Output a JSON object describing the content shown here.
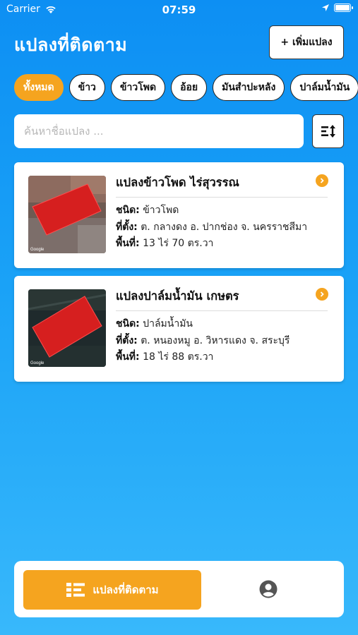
{
  "status_bar": {
    "carrier": "Carrier",
    "time": "07:59",
    "battery_percent": 100
  },
  "header": {
    "title": "แปลงที่ติดตาม",
    "add_button_label": "+ เพิ่มแปลง"
  },
  "filters": {
    "selected": "ทั้งหมด",
    "chips": [
      "ทั้งหมด",
      "ข้าว",
      "ข้าวโพด",
      "อ้อย",
      "มันสำปะหลัง",
      "ปาล์มน้ำมัน"
    ]
  },
  "search": {
    "placeholder": "ค้นหาชื่อแปลง ...",
    "value": ""
  },
  "plots": [
    {
      "name": "แปลงข้าวโพด ไร่สุวรรณ",
      "type_label": "ชนิด:",
      "type": "ข้าวโพด",
      "location_label": "ที่ตั้ง:",
      "location": "ต. กลางดง อ. ปากช่อง จ. นครราชสีมา",
      "area_label": "พื้นที่:",
      "area": "13 ไร่ 70 ตร.วา",
      "map_watermark": "Google"
    },
    {
      "name": "แปลงปาล์มน้ำมัน เกษตร",
      "type_label": "ชนิด:",
      "type": "ปาล์มน้ำมัน",
      "location_label": "ที่ตั้ง:",
      "location": "ต. หนองหมู อ. วิหารแดง จ. สระบุรี",
      "area_label": "พื้นที่:",
      "area": "18 ไร่ 88 ตร.วา",
      "map_watermark": "Google"
    }
  ],
  "bottom_nav": {
    "active_tab_label": "แปลงที่ติดตาม"
  },
  "colors": {
    "accent": "#f5a41f",
    "background_top": "#0d8ff3",
    "plot_overlay": "#d61f1f"
  }
}
